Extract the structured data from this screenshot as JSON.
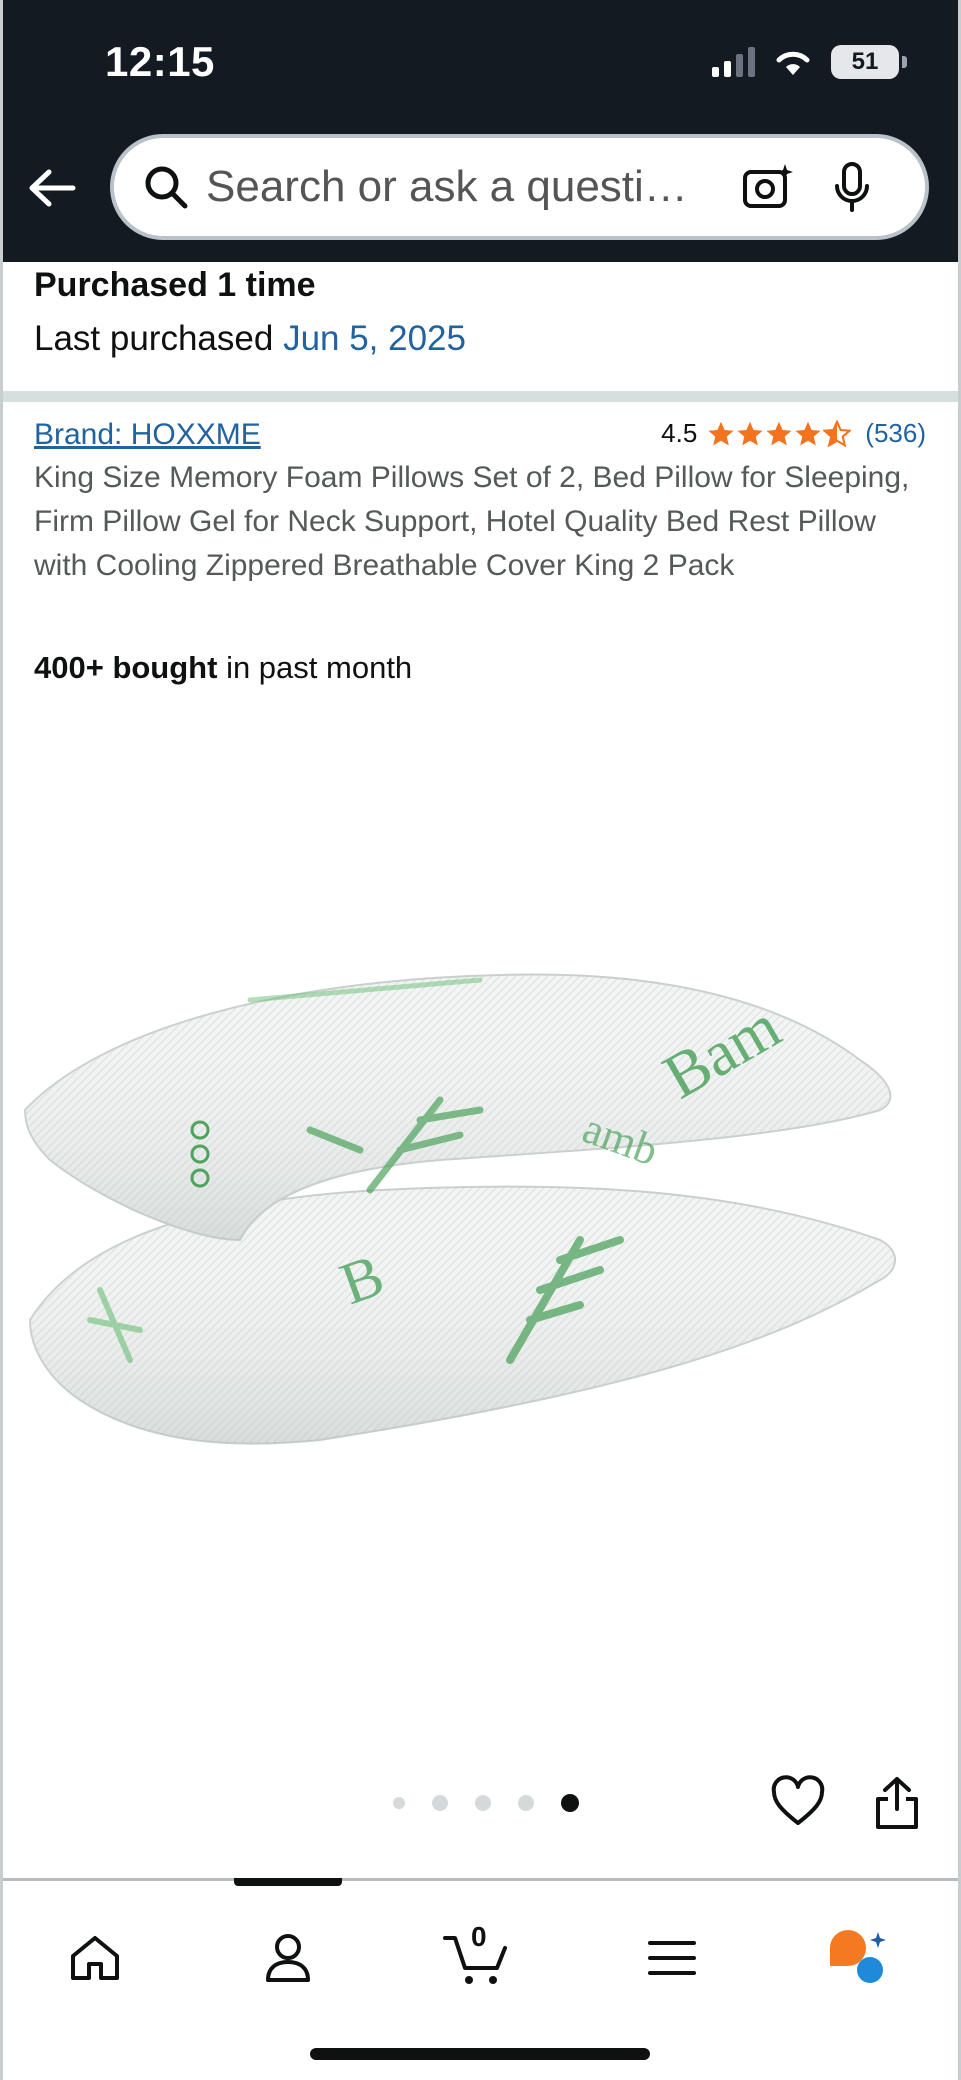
{
  "status_bar": {
    "time": "12:15",
    "battery": "51"
  },
  "search": {
    "placeholder": "Search or ask a questi…"
  },
  "purchase": {
    "times": "Purchased 1 time",
    "last_label": "Last purchased",
    "last_date": "Jun 5, 2025"
  },
  "product": {
    "brand": "Brand: HOXXME",
    "rating": "4.5",
    "rating_value": 4.5,
    "review_count": "(536)",
    "title": "King Size Memory Foam Pillows Set of 2, Bed Pillow for Sleeping, Firm Pillow Gel for Neck Support, Hotel Quality Bed Rest Pillow with Cooling Zippered Breathable Cover King 2 Pack",
    "bought_bold": "400+ bought",
    "bought_rest": " in past month",
    "image_count": 5,
    "active_image": 5
  },
  "bottom_nav": {
    "cart_count": "0",
    "items": [
      "home-icon",
      "account-icon",
      "cart-icon",
      "menu-icon",
      "rufus-icon"
    ]
  },
  "colors": {
    "header_bg": "#131a22",
    "link": "#2162a1",
    "star": "#f4731f"
  }
}
